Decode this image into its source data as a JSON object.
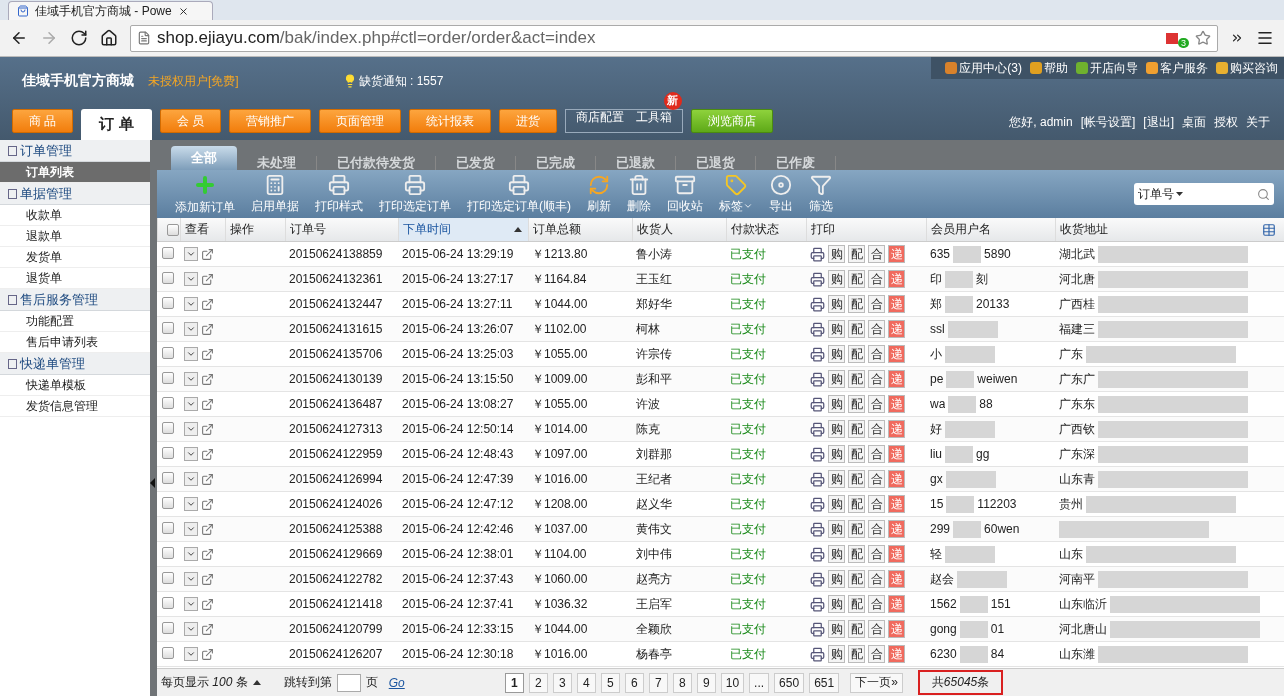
{
  "browser": {
    "tab_title": "佳域手机官方商城 - Powe",
    "url_domain": "shop.ejiayu.com",
    "url_path": "/bak/index.php#ctl=order/order&act=index",
    "extension_badge": "3"
  },
  "header": {
    "title": "佳域手机官方商城",
    "license": "未授权用户[免费]",
    "notice": "缺货通知 : 1557",
    "top_links": [
      {
        "label": "应用中心(3)",
        "color": "#d9822b"
      },
      {
        "label": "帮助",
        "color": "#e0a020"
      },
      {
        "label": "开店向导",
        "color": "#6fb12e"
      },
      {
        "label": "客户服务",
        "color": "#f0a030"
      },
      {
        "label": "购买咨询",
        "color": "#e8b030"
      }
    ],
    "nav": [
      {
        "kind": "tab",
        "label": "商 品",
        "selected": false
      },
      {
        "kind": "tab",
        "label": "订 单",
        "selected": true
      },
      {
        "kind": "tab",
        "label": "会 员",
        "selected": false
      },
      {
        "kind": "tab",
        "label": "营销推广",
        "selected": false
      },
      {
        "kind": "tab",
        "label": "页面管理",
        "selected": false
      },
      {
        "kind": "tab",
        "label": "统计报表",
        "selected": false
      },
      {
        "kind": "tab",
        "label": "进货",
        "selected": false
      },
      {
        "kind": "outlined",
        "label": "商店配置"
      },
      {
        "kind": "outlined",
        "label": "工具箱",
        "badge": "新"
      },
      {
        "kind": "green",
        "label": "浏览商店"
      }
    ],
    "user_links": [
      "您好, admin",
      "[帐号设置]",
      "[退出]",
      "桌面",
      "授权",
      "关于"
    ]
  },
  "sidebar": [
    {
      "label": "订单管理",
      "children": [
        {
          "label": "订单列表",
          "selected": true
        }
      ]
    },
    {
      "label": "单据管理",
      "children": [
        {
          "label": "收款单",
          "selected": false
        },
        {
          "label": "退款单",
          "selected": false
        },
        {
          "label": "发货单",
          "selected": false
        },
        {
          "label": "退货单",
          "selected": false
        }
      ]
    },
    {
      "label": "售后服务管理",
      "children": [
        {
          "label": "功能配置",
          "selected": false
        },
        {
          "label": "售后申请列表",
          "selected": false
        }
      ]
    },
    {
      "label": "快递单管理",
      "children": [
        {
          "label": "快递单模板",
          "selected": false
        },
        {
          "label": "发货信息管理",
          "selected": false
        }
      ]
    }
  ],
  "tabs": [
    {
      "label": "全部",
      "selected": true
    },
    {
      "label": "未处理",
      "selected": false
    },
    {
      "label": "已付款待发货",
      "selected": false
    },
    {
      "label": "已发货",
      "selected": false
    },
    {
      "label": "已完成",
      "selected": false
    },
    {
      "label": "已退款",
      "selected": false
    },
    {
      "label": "已退货",
      "selected": false
    },
    {
      "label": "已作废",
      "selected": false
    }
  ],
  "toolbar": [
    {
      "kind": "add",
      "label": "添加新订单"
    },
    {
      "kind": "calc",
      "label": "启用单据"
    },
    {
      "kind": "print",
      "label": "打印样式"
    },
    {
      "kind": "print",
      "label": "打印选定订单"
    },
    {
      "kind": "print",
      "label": "打印选定订单(顺丰)"
    },
    {
      "kind": "refresh",
      "label": "刷新"
    },
    {
      "kind": "delete",
      "label": "删除"
    },
    {
      "kind": "bin",
      "label": "回收站"
    },
    {
      "kind": "tag",
      "label": "标签"
    },
    {
      "kind": "export",
      "label": "导出"
    },
    {
      "kind": "filter",
      "label": "筛选"
    }
  ],
  "search": {
    "field": "订单号"
  },
  "table": {
    "select_all_checked": false,
    "columns": [
      {
        "label": "查看",
        "sorted": false
      },
      {
        "label": "操作",
        "sorted": false
      },
      {
        "label": "订单号",
        "sorted": false
      },
      {
        "label": "下单时间",
        "sorted": true
      },
      {
        "label": "订单总额",
        "sorted": false
      },
      {
        "label": "收货人",
        "sorted": false
      },
      {
        "label": "付款状态",
        "sorted": false
      },
      {
        "label": "打印",
        "sorted": false
      },
      {
        "label": "会员用户名",
        "sorted": false
      },
      {
        "label": "收货地址",
        "sorted": false
      }
    ],
    "rows": [
      {
        "checked": false,
        "order": "20150624138859",
        "time": "2015-06-24 13:29:19",
        "total": "￥1213.80",
        "consignee": "鲁小涛",
        "status": "已支付",
        "print": [
          "购",
          "配",
          "合"
        ],
        "express": "递",
        "member": [
          "635",
          "5890"
        ],
        "address": "湖北武"
      },
      {
        "checked": false,
        "order": "20150624132361",
        "time": "2015-06-24 13:27:17",
        "total": "￥1164.84",
        "consignee": "王玉红",
        "status": "已支付",
        "print": [
          "购",
          "配",
          "合"
        ],
        "express": "递",
        "member": [
          "印",
          "刻"
        ],
        "address": "河北唐"
      },
      {
        "checked": false,
        "order": "20150624132447",
        "time": "2015-06-24 13:27:11",
        "total": "￥1044.00",
        "consignee": "郑好华",
        "status": "已支付",
        "print": [
          "购",
          "配",
          "合"
        ],
        "express": "递",
        "member": [
          "郑",
          "20133"
        ],
        "address": "广西桂"
      },
      {
        "checked": false,
        "order": "20150624131615",
        "time": "2015-06-24 13:26:07",
        "total": "￥1102.00",
        "consignee": "柯林",
        "status": "已支付",
        "print": [
          "购",
          "配",
          "合"
        ],
        "express": "递",
        "member": [
          "ssl"
        ],
        "address": "福建三"
      },
      {
        "checked": false,
        "order": "20150624135706",
        "time": "2015-06-24 13:25:03",
        "total": "￥1055.00",
        "consignee": "许宗传",
        "status": "已支付",
        "print": [
          "购",
          "配",
          "合"
        ],
        "express": "递",
        "member": [
          "小"
        ],
        "address": "广东"
      },
      {
        "checked": false,
        "order": "20150624130139",
        "time": "2015-06-24 13:15:50",
        "total": "￥1009.00",
        "consignee": "彭和平",
        "status": "已支付",
        "print": [
          "购",
          "配",
          "合"
        ],
        "express": "递",
        "member": [
          "pe",
          "weiwen"
        ],
        "address": "广东广"
      },
      {
        "checked": false,
        "order": "20150624136487",
        "time": "2015-06-24 13:08:27",
        "total": "￥1055.00",
        "consignee": "许波",
        "status": "已支付",
        "print": [
          "购",
          "配",
          "合"
        ],
        "express": "递",
        "member": [
          "wa",
          "88"
        ],
        "address": "广东东"
      },
      {
        "checked": false,
        "order": "20150624127313",
        "time": "2015-06-24 12:50:14",
        "total": "￥1014.00",
        "consignee": "陈克",
        "status": "已支付",
        "print": [
          "购",
          "配",
          "合"
        ],
        "express": "递",
        "member": [
          "好"
        ],
        "address": "广西钦"
      },
      {
        "checked": false,
        "order": "20150624122959",
        "time": "2015-06-24 12:48:43",
        "total": "￥1097.00",
        "consignee": "刘群那",
        "status": "已支付",
        "print": [
          "购",
          "配",
          "合"
        ],
        "express": "递",
        "member": [
          "liu",
          "gg"
        ],
        "address": "广东深"
      },
      {
        "checked": false,
        "order": "20150624126994",
        "time": "2015-06-24 12:47:39",
        "total": "￥1016.00",
        "consignee": "王纪者",
        "status": "已支付",
        "print": [
          "购",
          "配",
          "合"
        ],
        "express": "递",
        "member": [
          "gx"
        ],
        "address": "山东青"
      },
      {
        "checked": false,
        "order": "20150624124026",
        "time": "2015-06-24 12:47:12",
        "total": "￥1208.00",
        "consignee": "赵义华",
        "status": "已支付",
        "print": [
          "购",
          "配",
          "合"
        ],
        "express": "递",
        "member": [
          "15",
          "112203"
        ],
        "address": "贵州"
      },
      {
        "checked": false,
        "order": "20150624125388",
        "time": "2015-06-24 12:42:46",
        "total": "￥1037.00",
        "consignee": "黄伟文",
        "status": "已支付",
        "print": [
          "购",
          "配",
          "合"
        ],
        "express": "递",
        "member": [
          "299",
          "60wen"
        ]
      },
      {
        "checked": false,
        "order": "20150624129669",
        "time": "2015-06-24 12:38:01",
        "total": "￥1104.00",
        "consignee": "刘中伟",
        "status": "已支付",
        "print": [
          "购",
          "配",
          "合"
        ],
        "express": "递",
        "member": [
          "轻"
        ],
        "address": "山东"
      },
      {
        "checked": false,
        "order": "20150624122782",
        "time": "2015-06-24 12:37:43",
        "total": "￥1060.00",
        "consignee": "赵亮方",
        "status": "已支付",
        "print": [
          "购",
          "配",
          "合"
        ],
        "express": "递",
        "member": [
          "赵会"
        ],
        "address": "河南平"
      },
      {
        "checked": false,
        "order": "20150624121418",
        "time": "2015-06-24 12:37:41",
        "total": "￥1036.32",
        "consignee": "王启军",
        "status": "已支付",
        "print": [
          "购",
          "配",
          "合"
        ],
        "express": "递",
        "member": [
          "1562",
          "151"
        ],
        "address": "山东临沂"
      },
      {
        "checked": false,
        "order": "20150624120799",
        "time": "2015-06-24 12:33:15",
        "total": "￥1044.00",
        "consignee": "全颖欣",
        "status": "已支付",
        "print": [
          "购",
          "配",
          "合"
        ],
        "express": "递",
        "member": [
          "gong",
          "01"
        ],
        "address": "河北唐山"
      },
      {
        "checked": false,
        "order": "20150624126207",
        "time": "2015-06-24 12:30:18",
        "total": "￥1016.00",
        "consignee": "杨春亭",
        "status": "已支付",
        "print": [
          "购",
          "配",
          "合"
        ],
        "express": "递",
        "member": [
          "6230",
          "84"
        ],
        "address": "山东潍"
      }
    ]
  },
  "footer": {
    "per_page_label": "每页显示",
    "per_page": "100",
    "per_page_unit": "条",
    "jump_label": "跳转到第",
    "jump_unit": "页",
    "go": "Go",
    "pages": [
      {
        "label": "1",
        "selected": true
      },
      {
        "label": "2",
        "selected": false
      },
      {
        "label": "3",
        "selected": false
      },
      {
        "label": "4",
        "selected": false
      },
      {
        "label": "5",
        "selected": false
      },
      {
        "label": "6",
        "selected": false
      },
      {
        "label": "7",
        "selected": false
      },
      {
        "label": "8",
        "selected": false
      },
      {
        "label": "9",
        "selected": false
      },
      {
        "label": "10",
        "selected": false
      },
      {
        "label": "...",
        "selected": false
      },
      {
        "label": "650",
        "selected": false
      },
      {
        "label": "651",
        "selected": false
      }
    ],
    "next": "下一页»",
    "total_prefix": "共",
    "total": "65045",
    "total_suffix": "条"
  }
}
